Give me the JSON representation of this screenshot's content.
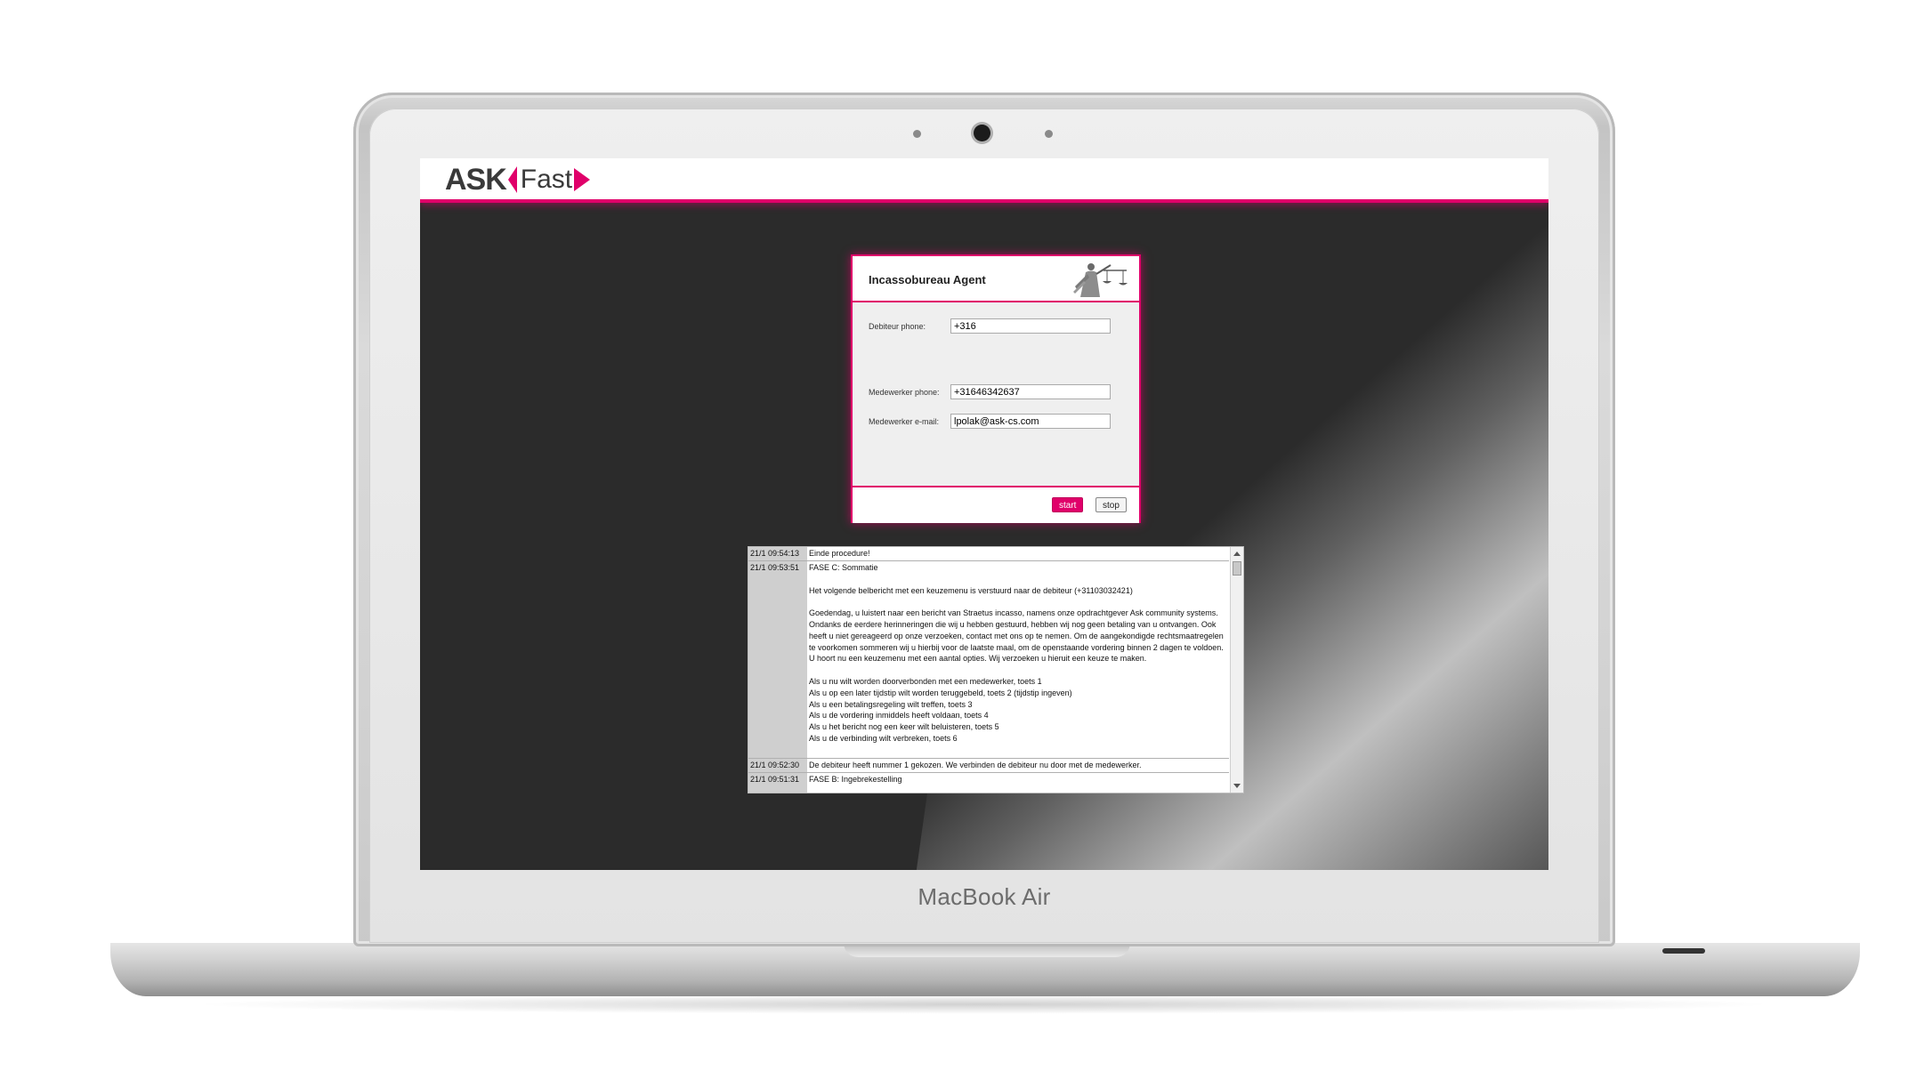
{
  "device": {
    "brand_label": "MacBook Air"
  },
  "app": {
    "logo_ask": "ASK",
    "logo_fast": "Fast",
    "accent_color": "#e0006a"
  },
  "form": {
    "title": "Incassobureau Agent",
    "debiteur_phone_label": "Debiteur phone:",
    "debiteur_phone_value": "+316",
    "medewerker_phone_label": "Medewerker phone:",
    "medewerker_phone_value": "+31646342637",
    "medewerker_email_label": "Medewerker e-mail:",
    "medewerker_email_value": "lpolak@ask-cs.com",
    "start_label": "start",
    "stop_label": "stop"
  },
  "log": {
    "entries": [
      {
        "time": "21/1 09:54:13",
        "message": "Einde procedure!"
      },
      {
        "time": "21/1 09:53:51",
        "message": "FASE C: Sommatie\n\nHet volgende belbericht met een keuzemenu is verstuurd naar de debiteur (+31103032421)\n\nGoedendag, u luistert naar een bericht van Straetus incasso, namens onze opdrachtgever Ask community systems. Ondanks de eerdere herinneringen die wij u hebben gestuurd, hebben wij nog geen betaling van u ontvangen. Ook heeft u niet gereageerd op onze verzoeken, contact met ons op te nemen. Om de aangekondigde rechtsmaatregelen te voorkomen sommeren wij u hierbij voor de laatste maal, om de openstaande vordering binnen 2 dagen te voldoen. U hoort nu een keuzemenu met een aantal opties. Wij verzoeken u hieruit een keuze te maken.\n\nAls u nu wilt worden doorverbonden met een medewerker, toets 1\nAls u op een later tijdstip wilt worden teruggebeld, toets 2 (tijdstip ingeven)\nAls u een betalingsregeling wilt treffen, toets 3\nAls u de vordering inmiddels heeft voldaan, toets 4\nAls u het bericht nog een keer wilt beluisteren, toets 5\nAls u de verbinding wilt verbreken, toets 6"
      },
      {
        "time": "21/1 09:52:30",
        "message": "De debiteur heeft nummer 1 gekozen. We verbinden de debiteur nu door met de medewerker."
      },
      {
        "time": "21/1 09:51:31",
        "message": "FASE B: Ingebrekestelling"
      }
    ]
  }
}
